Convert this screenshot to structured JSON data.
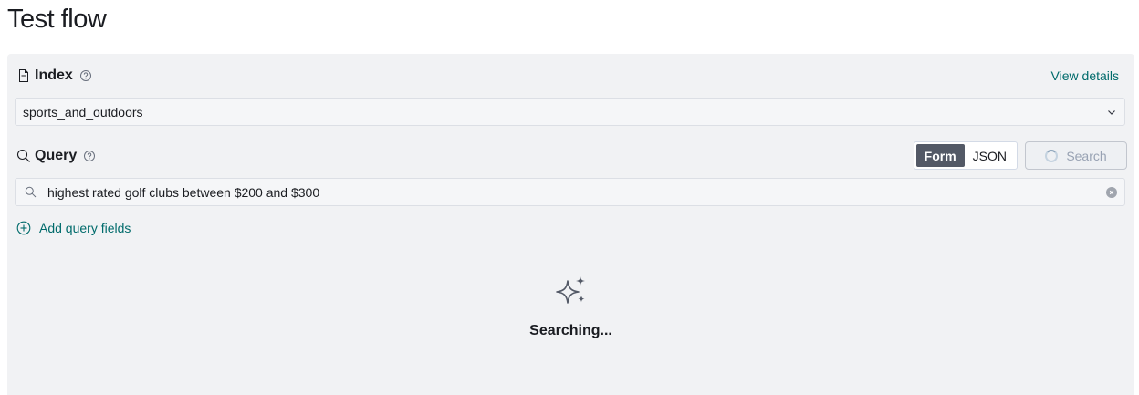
{
  "page": {
    "title": "Test flow"
  },
  "index_section": {
    "label": "Index",
    "view_details": "View details",
    "selected_index": "sports_and_outdoors"
  },
  "query_section": {
    "label": "Query",
    "mode_options": [
      "Form",
      "JSON"
    ],
    "active_mode": "Form",
    "search_button": "Search",
    "search_value": "highest rated golf clubs between $200 and $300",
    "add_fields": "Add query fields"
  },
  "results": {
    "status": "Searching..."
  },
  "icons": {
    "index": "document-icon",
    "help": "question-circle-icon",
    "query": "search-icon",
    "select": "chevron-down-icon",
    "clear": "clear-icon",
    "add": "plus-circle-icon",
    "empty": "sparkles-icon",
    "loading": "spinner-icon"
  },
  "colors": {
    "accent_link": "#006b6b",
    "panel_bg": "#f1f2f4",
    "toggle_active": "#535966"
  }
}
